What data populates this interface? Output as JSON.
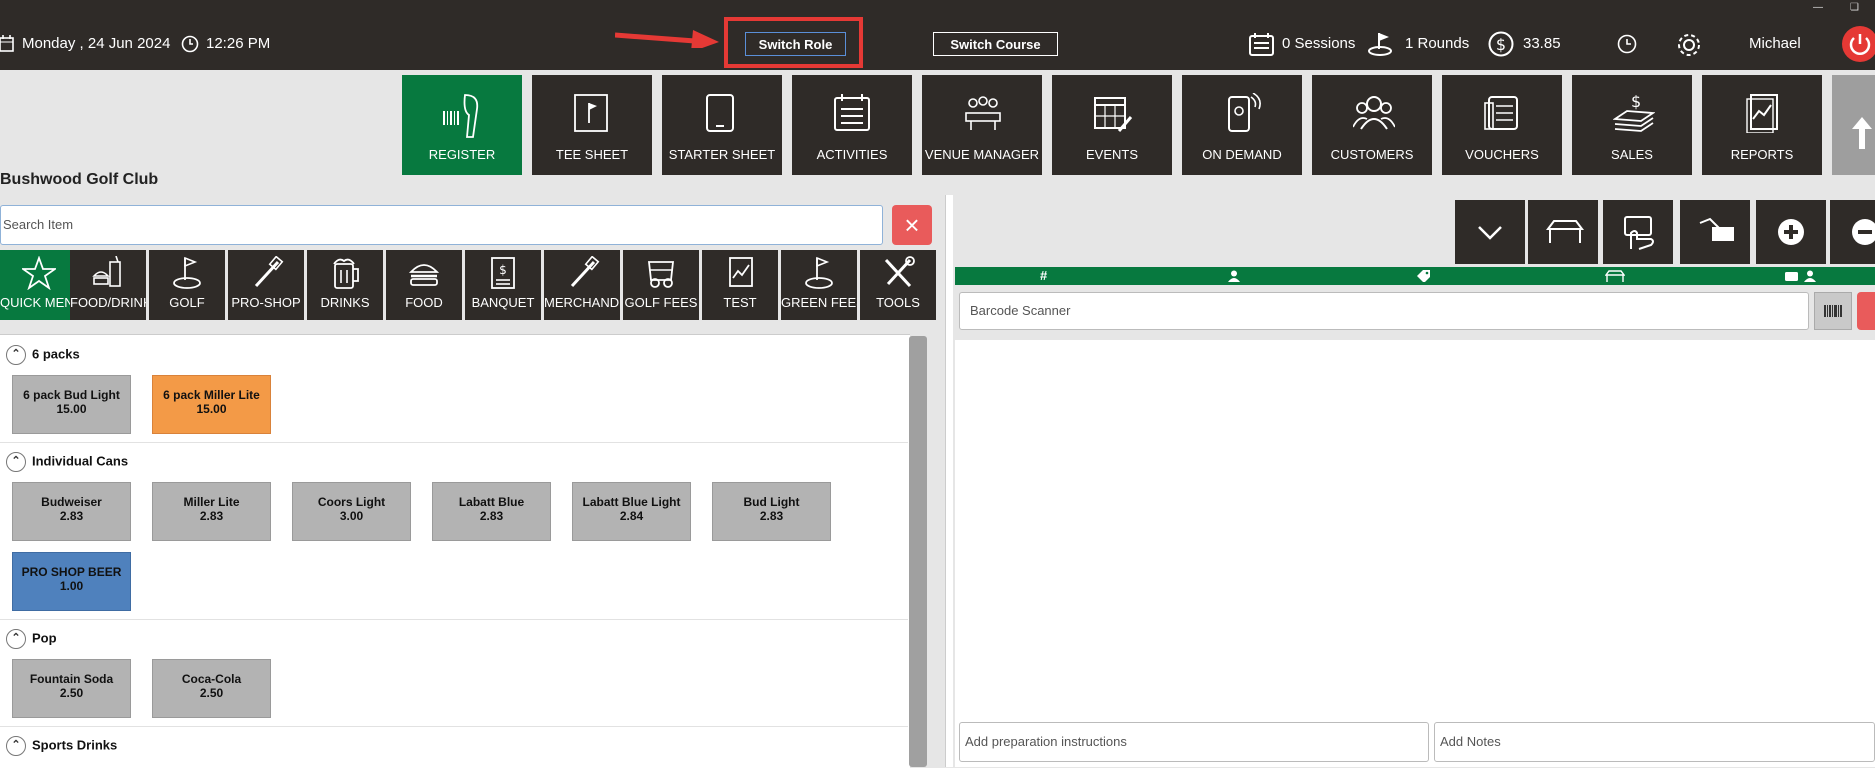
{
  "topbar": {
    "date": "Monday ,  24 Jun 2024",
    "time": "12:26 PM",
    "switch_role": "Switch Role",
    "switch_course": "Switch Course",
    "sessions": "0 Sessions",
    "rounds": "1 Rounds",
    "balance": "33.85",
    "user": "Michael"
  },
  "nav": [
    {
      "label": "REGISTER",
      "icon": "scanner-icon",
      "active": true
    },
    {
      "label": "TEE SHEET",
      "icon": "flag-board-icon"
    },
    {
      "label": "STARTER SHEET",
      "icon": "tablet-icon"
    },
    {
      "label": "ACTIVITIES",
      "icon": "calendar-list-icon"
    },
    {
      "label": "VENUE MANAGER",
      "icon": "meeting-table-icon"
    },
    {
      "label": "EVENTS",
      "icon": "calendar-edit-icon"
    },
    {
      "label": "ON DEMAND",
      "icon": "phone-signal-icon"
    },
    {
      "label": "CUSTOMERS",
      "icon": "people-icon"
    },
    {
      "label": "VOUCHERS",
      "icon": "voucher-icon"
    },
    {
      "label": "SALES",
      "icon": "money-stack-icon"
    },
    {
      "label": "REPORTS",
      "icon": "report-icon"
    }
  ],
  "club_name": "Bushwood Golf Club",
  "search": {
    "placeholder": "Search Item"
  },
  "categories": [
    {
      "label": "QUICK MENU",
      "active": true
    },
    {
      "label": "FOOD/DRINKS"
    },
    {
      "label": "GOLF"
    },
    {
      "label": "PRO-SHOP"
    },
    {
      "label": "DRINKS"
    },
    {
      "label": "FOOD"
    },
    {
      "label": "BANQUET"
    },
    {
      "label": "MERCHANDISE"
    },
    {
      "label": "GOLF FEES"
    },
    {
      "label": "TEST"
    },
    {
      "label": "GREEN FEES"
    },
    {
      "label": "TOOLS"
    }
  ],
  "sections": [
    {
      "title": "6 packs",
      "items": [
        {
          "name": "6 pack Bud Light",
          "price": "15.00",
          "color": "#b3b3b3"
        },
        {
          "name": "6 pack Miller Lite",
          "price": "15.00",
          "color": "#f39a47"
        }
      ]
    },
    {
      "title": "Individual Cans",
      "items": [
        {
          "name": "Budweiser",
          "price": "2.83",
          "color": "#b3b3b3"
        },
        {
          "name": "Miller Lite",
          "price": "2.83",
          "color": "#b3b3b3"
        },
        {
          "name": "Coors Light",
          "price": "3.00",
          "color": "#b3b3b3"
        },
        {
          "name": "Labatt Blue",
          "price": "2.83",
          "color": "#b3b3b3"
        },
        {
          "name": "Labatt Blue Light",
          "price": "2.84",
          "color": "#b3b3b3"
        },
        {
          "name": "Bud Light",
          "price": "2.83",
          "color": "#b3b3b3"
        },
        {
          "name": "PRO SHOP BEER",
          "price": "1.00",
          "color": "#4f81bd"
        }
      ]
    },
    {
      "title": "Pop",
      "items": [
        {
          "name": "Fountain Soda",
          "price": "2.50",
          "color": "#b3b3b3"
        },
        {
          "name": "Coca-Cola",
          "price": "2.50",
          "color": "#b3b3b3"
        }
      ]
    },
    {
      "title": "Sports Drinks",
      "items": []
    }
  ],
  "order": {
    "barcode_placeholder": "Barcode Scanner",
    "prep_placeholder": "Add preparation instructions",
    "notes_placeholder": "Add Notes"
  },
  "colors": {
    "dark": "#2f2b28",
    "accent_green": "#07793f",
    "danger": "#e95b5b",
    "highlight": "#e53935"
  }
}
